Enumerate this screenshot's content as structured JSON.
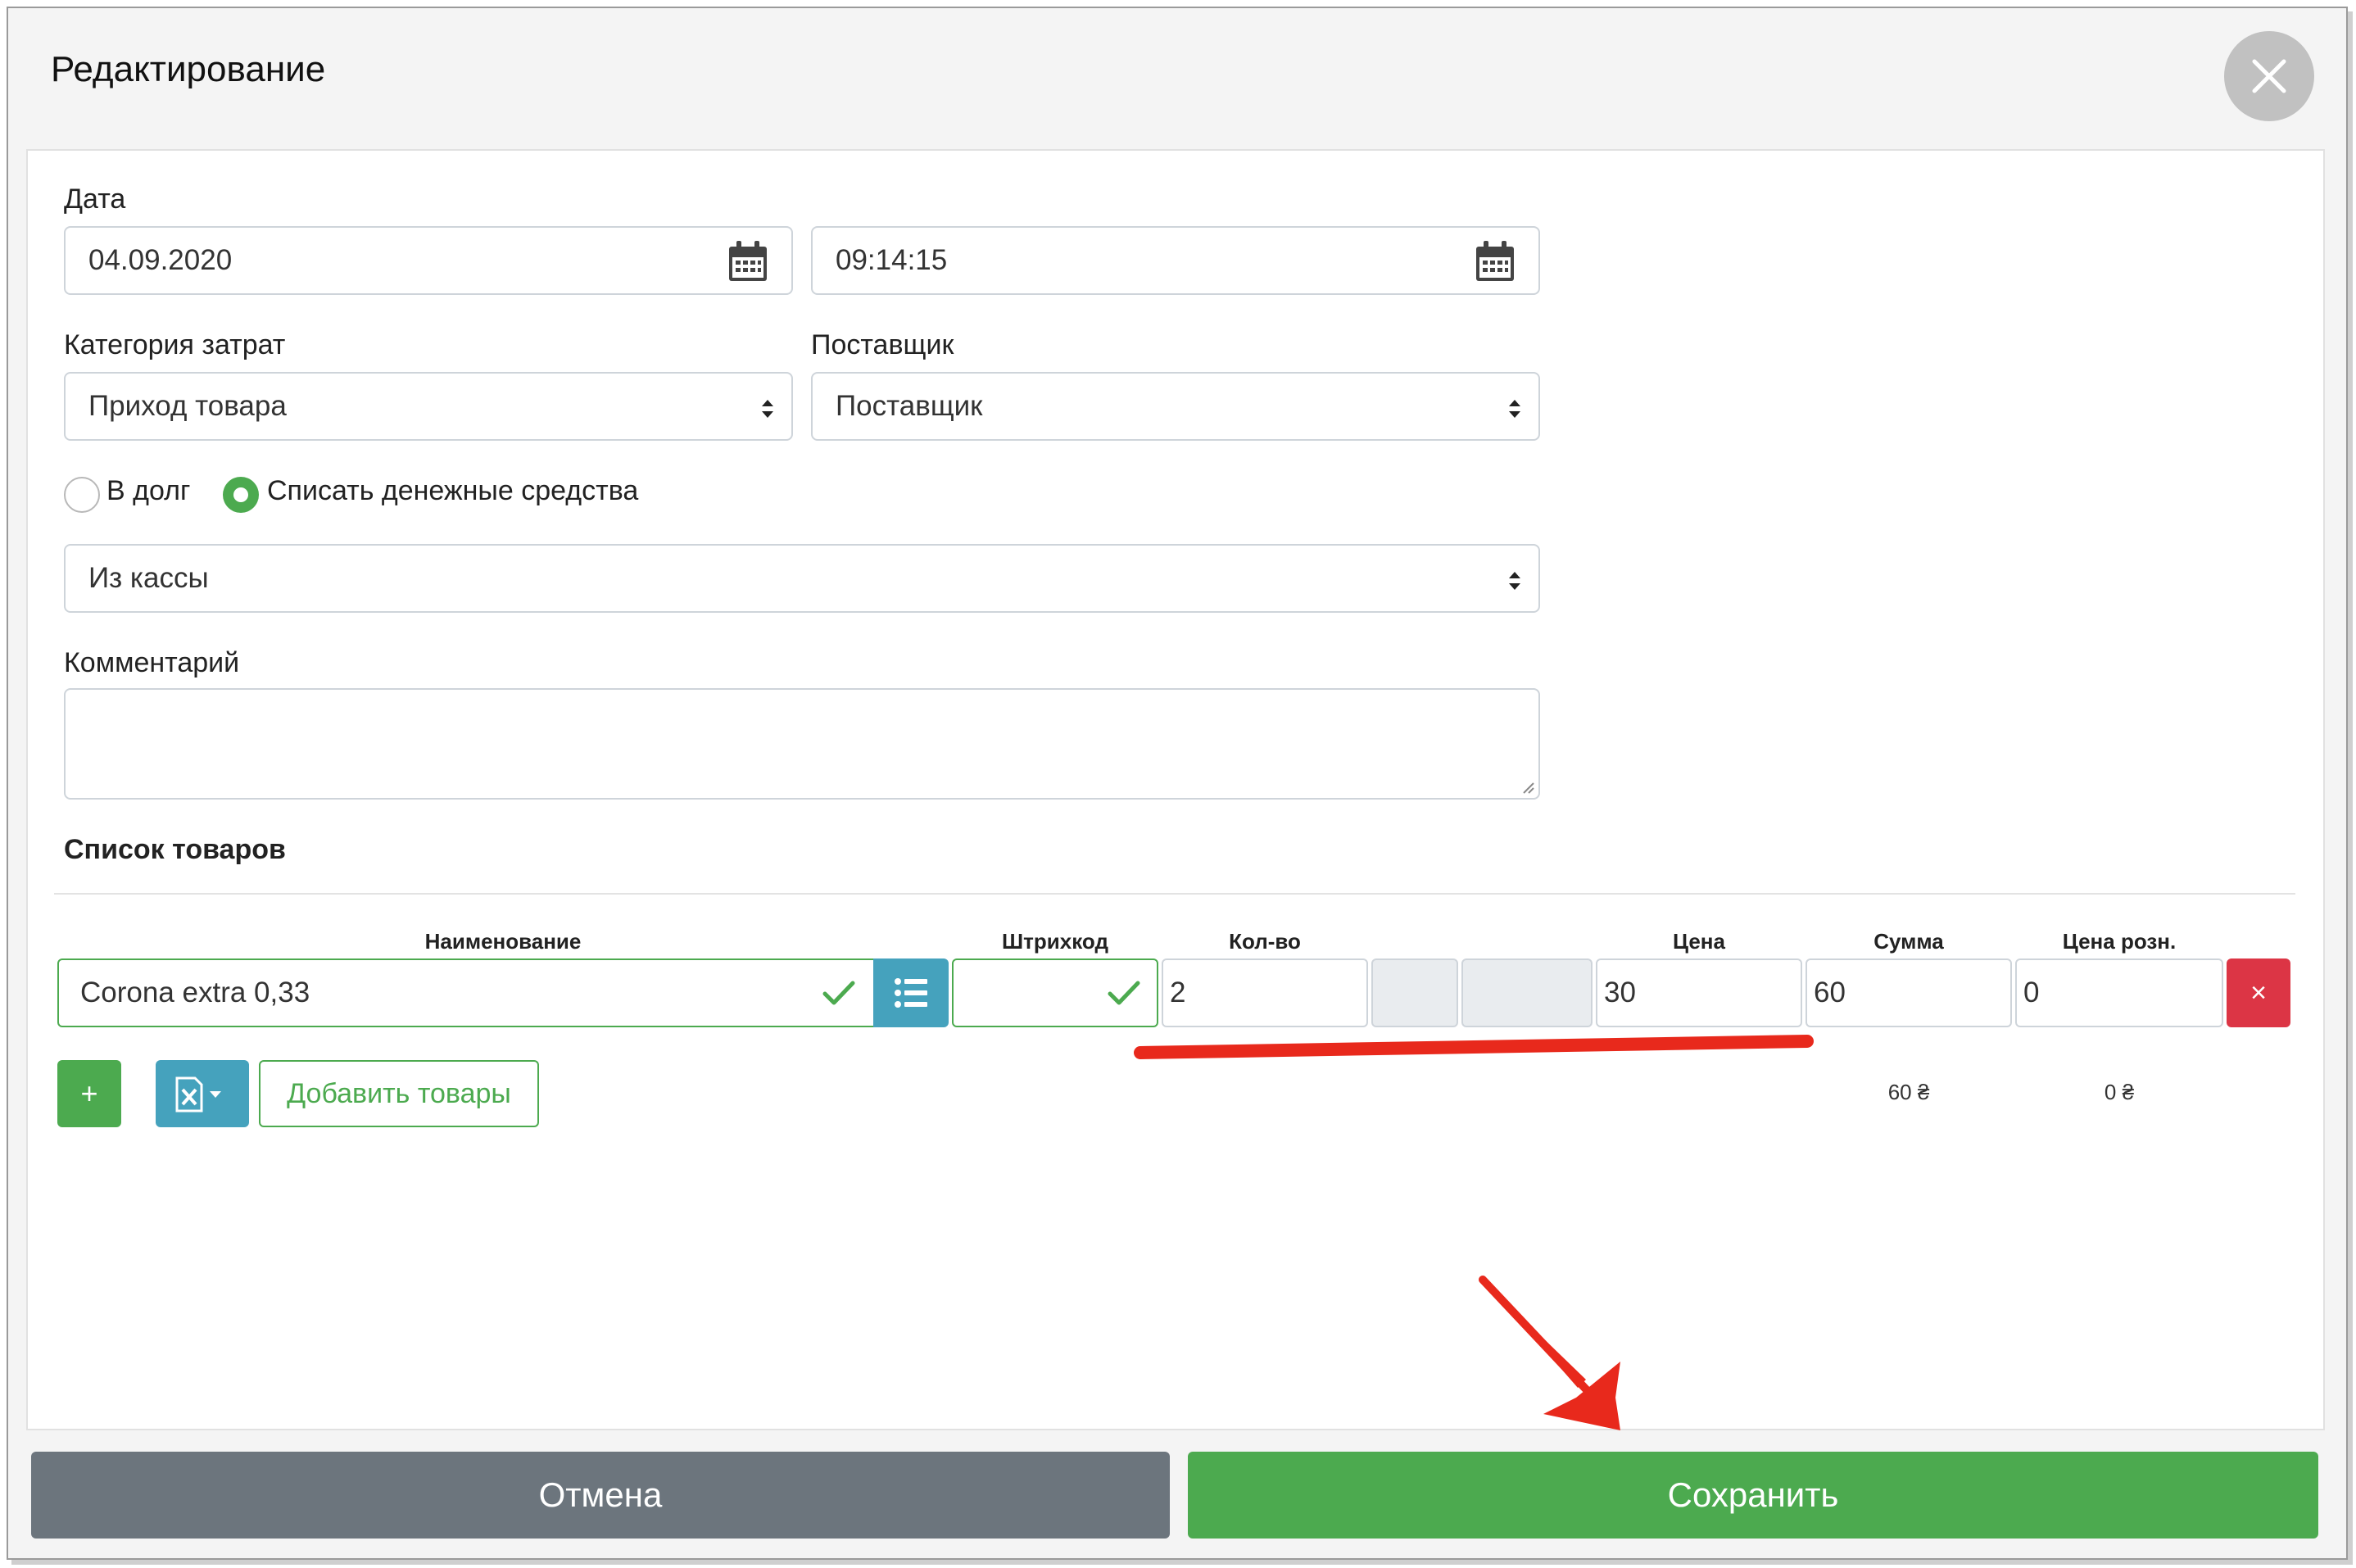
{
  "dialog": {
    "title": "Редактирование",
    "close_icon": "close-icon"
  },
  "form": {
    "date_label": "Дата",
    "date_value": "04.09.2020",
    "time_value": "09:14:15",
    "category_label": "Категория затрат",
    "category_value": "Приход товара",
    "supplier_label": "Поставщик",
    "supplier_value": "Поставщик",
    "radio_debt_label": "В долг",
    "radio_cash_label": "Списать денежные средства",
    "radio_selected": "cash",
    "source_value": "Из кассы",
    "comment_label": "Комментарий",
    "comment_value": ""
  },
  "products": {
    "section_title": "Список товаров",
    "columns": {
      "name": "Наименование",
      "barcode": "Штрихкод",
      "qty": "Кол-во",
      "price": "Цена",
      "sum": "Сумма",
      "retail_price": "Цена розн."
    },
    "rows": [
      {
        "name": "Corona extra 0,33",
        "barcode": "",
        "qty": "2",
        "price": "30",
        "sum": "60",
        "retail_price": "0"
      }
    ],
    "totals": {
      "sum": "60 ₴",
      "retail": "0 ₴"
    },
    "add_button_label": "+",
    "add_products_label": "Добавить товары",
    "remove_button_label": "×"
  },
  "footer": {
    "cancel_label": "Отмена",
    "save_label": "Сохранить"
  },
  "colors": {
    "green": "#4caa4f",
    "teal": "#45a2bd",
    "red": "#dc3545",
    "grey": "#6c757d",
    "annotation": "#e8291c"
  }
}
